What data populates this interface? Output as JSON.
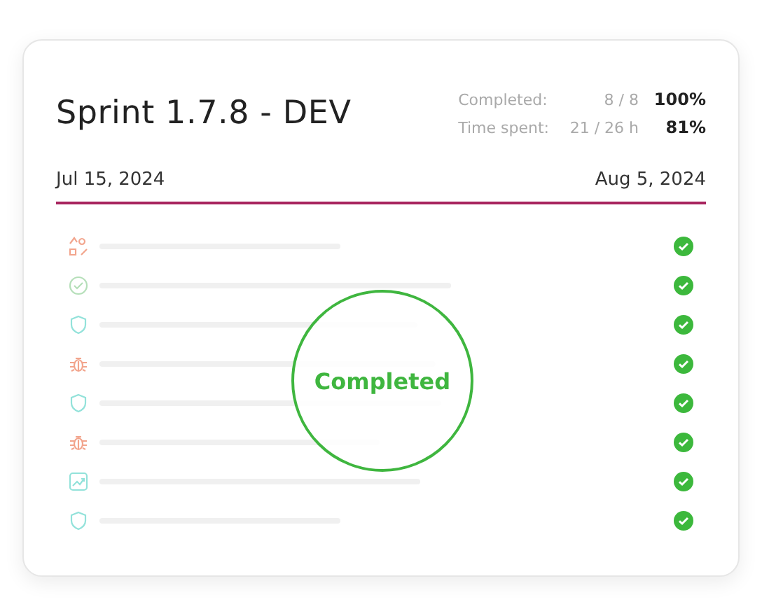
{
  "sprint": {
    "title": "Sprint 1.7.8 - DEV",
    "start_date": "Jul 15, 2024",
    "end_date": "Aug 5, 2024"
  },
  "stats": [
    {
      "label": "Completed:",
      "value": "8 / 8",
      "percent": "100%"
    },
    {
      "label": "Time spent:",
      "value": "21 / 26 h",
      "percent": "81%"
    }
  ],
  "tasks": [
    {
      "kind": "shapes",
      "done": true
    },
    {
      "kind": "check",
      "done": true
    },
    {
      "kind": "shield",
      "done": true
    },
    {
      "kind": "bug",
      "done": true
    },
    {
      "kind": "shield",
      "done": true
    },
    {
      "kind": "bug",
      "done": true
    },
    {
      "kind": "chart",
      "done": true
    },
    {
      "kind": "shield",
      "done": true
    }
  ],
  "stamp": {
    "text": "Completed"
  }
}
